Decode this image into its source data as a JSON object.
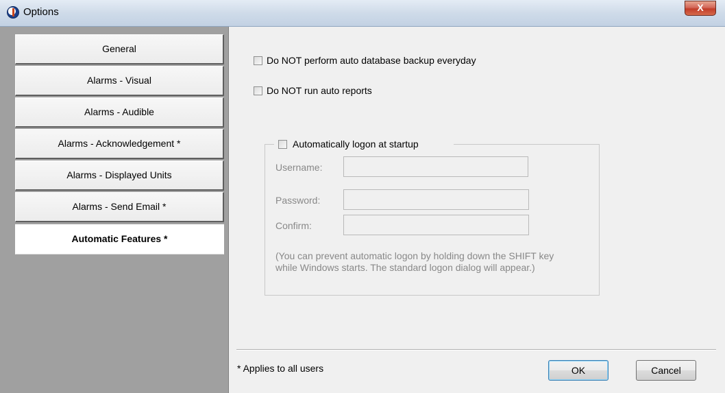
{
  "window": {
    "title": "Options",
    "close_label": "X"
  },
  "nav": {
    "items": [
      {
        "label": "General"
      },
      {
        "label": "Alarms - Visual"
      },
      {
        "label": "Alarms - Audible"
      },
      {
        "label": "Alarms - Acknowledgement *"
      },
      {
        "label": "Alarms - Displayed Units"
      },
      {
        "label": "Alarms - Send Email *"
      },
      {
        "label": "Automatic Features *",
        "selected": true
      }
    ]
  },
  "options": {
    "no_backup": {
      "label": "Do NOT perform auto database backup everyday",
      "checked": false
    },
    "no_reports": {
      "label": "Do NOT run auto reports",
      "checked": false
    }
  },
  "autologon": {
    "label": "Automatically logon at startup",
    "checked": false,
    "username_label": "Username:",
    "username_value": "",
    "password_label": "Password:",
    "password_value": "",
    "confirm_label": "Confirm:",
    "confirm_value": "",
    "note": "(You can prevent automatic logon by holding down the SHIFT key while Windows starts. The standard logon dialog will appear.)"
  },
  "footer": {
    "footnote": "* Applies to all users",
    "ok_label": "OK",
    "cancel_label": "Cancel"
  }
}
